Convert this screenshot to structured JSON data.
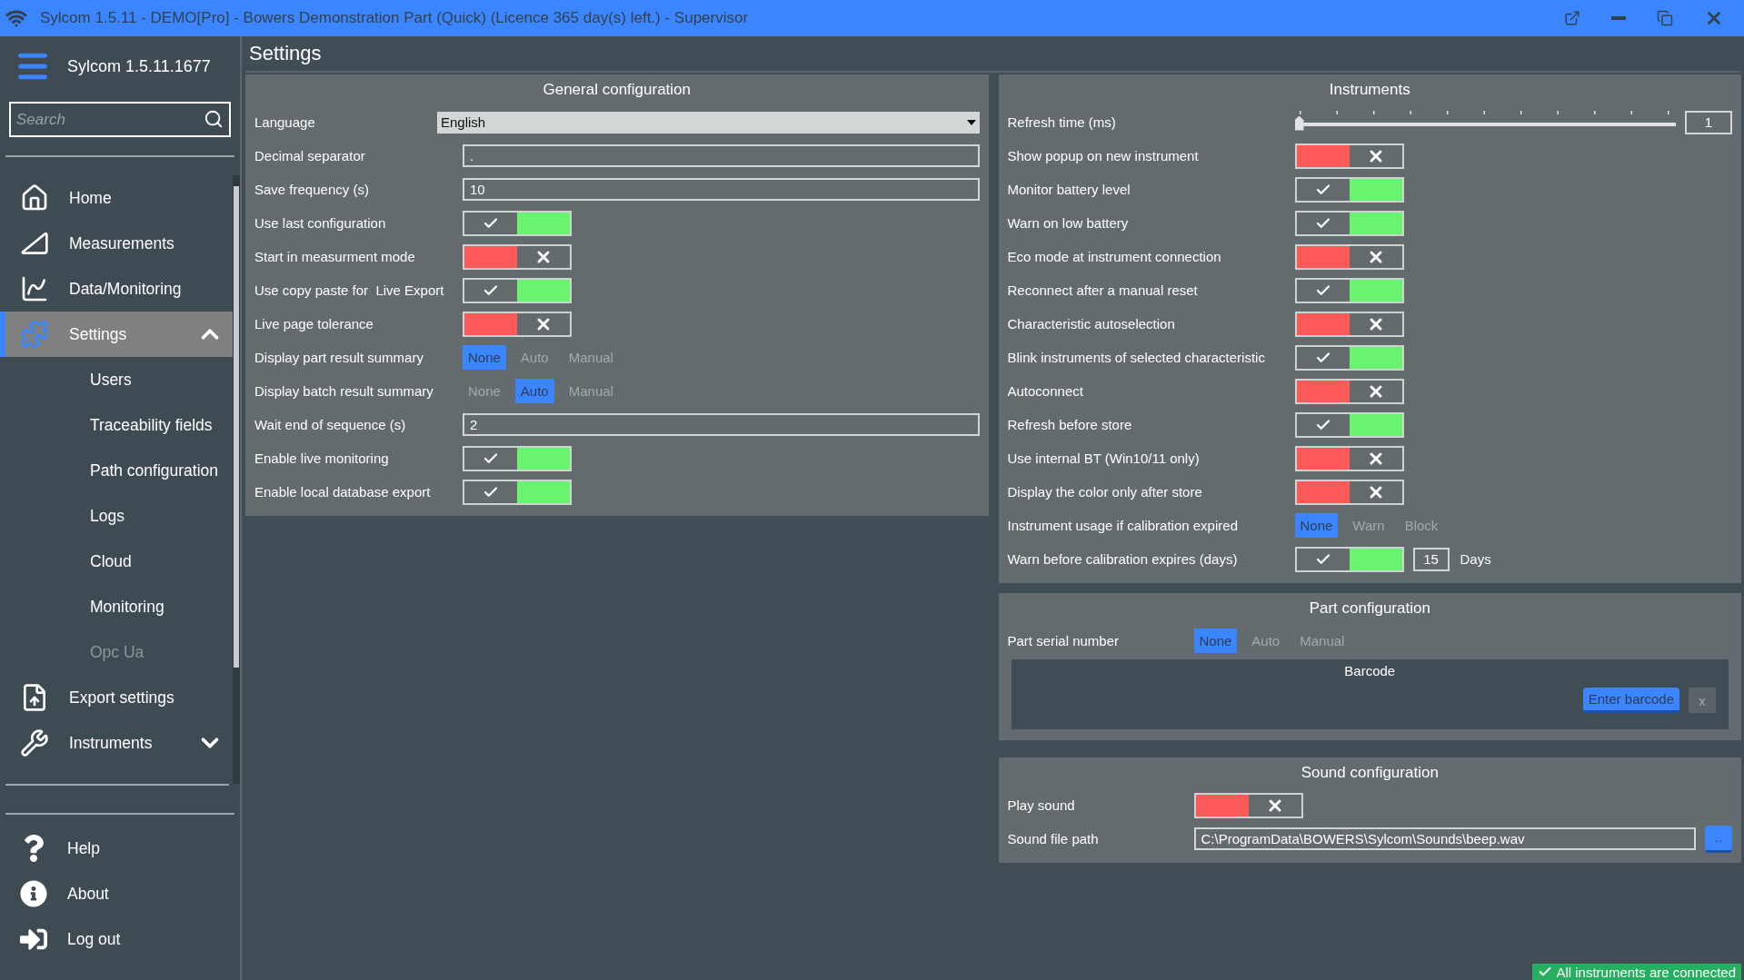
{
  "title_bar": {
    "title": "Sylcom 1.5.11 - DEMO[Pro] - Bowers Demonstration Part (Quick) (Licence 365 day(s) left.) - Supervisor"
  },
  "sidebar": {
    "app_name": "Sylcom 1.5.11.1677",
    "search_placeholder": "Search",
    "items": [
      {
        "label": "Home",
        "selected": false
      },
      {
        "label": "Measurements",
        "selected": false
      },
      {
        "label": "Data/Monitoring",
        "selected": false
      },
      {
        "label": "Settings",
        "selected": true,
        "expanded": true,
        "children": [
          {
            "label": "Users",
            "selected": false,
            "disabled": false
          },
          {
            "label": "Traceability fields",
            "selected": false,
            "disabled": false
          },
          {
            "label": "Path configuration",
            "selected": false,
            "disabled": false
          },
          {
            "label": "Logs",
            "selected": false,
            "disabled": false
          },
          {
            "label": "Cloud",
            "selected": false,
            "disabled": false
          },
          {
            "label": "Monitoring",
            "selected": false,
            "disabled": false
          },
          {
            "label": "Opc Ua",
            "selected": false,
            "disabled": true
          }
        ]
      },
      {
        "label": "Export settings",
        "selected": false
      },
      {
        "label": "Instruments",
        "selected": false,
        "expanded": false
      }
    ],
    "footer_items": [
      {
        "label": "Help"
      },
      {
        "label": "About"
      },
      {
        "label": "Log out"
      }
    ]
  },
  "page_title": "Settings",
  "general": {
    "title": "General configuration",
    "rows": [
      {
        "kind": "dropdown",
        "label": "Language",
        "value": "English"
      },
      {
        "kind": "text",
        "label": "Decimal separator",
        "value": "."
      },
      {
        "kind": "text",
        "label": "Save frequency (s)",
        "value": "10"
      },
      {
        "kind": "toggle",
        "label": "Use last configuration",
        "on": true
      },
      {
        "kind": "toggle",
        "label": "Start in measurment mode",
        "on": false
      },
      {
        "kind": "toggle",
        "label": "Use copy paste for  Live Export",
        "on": true
      },
      {
        "kind": "toggle",
        "label": "Live page tolerance",
        "on": false
      },
      {
        "kind": "choice",
        "label": "Display part result summary",
        "options": [
          {
            "label": "None",
            "selected": true
          },
          {
            "label": "Auto",
            "selected": false
          },
          {
            "label": "Manual",
            "selected": false
          }
        ]
      },
      {
        "kind": "choice",
        "label": "Display batch result summary",
        "options": [
          {
            "label": "None",
            "selected": false
          },
          {
            "label": "Auto",
            "selected": true
          },
          {
            "label": "Manual",
            "selected": false
          }
        ]
      },
      {
        "kind": "text",
        "label": "Wait end of sequence (s)",
        "value": "2"
      },
      {
        "kind": "toggle",
        "label": "Enable live monitoring",
        "on": true
      },
      {
        "kind": "toggle",
        "label": "Enable local database export",
        "on": true
      }
    ]
  },
  "instruments": {
    "title": "Instruments",
    "rows": [
      {
        "kind": "slider",
        "label": "Refresh time (ms)",
        "level": 0,
        "value": "1"
      },
      {
        "kind": "toggle",
        "label": "Show popup on new instrument",
        "on": false
      },
      {
        "kind": "toggle",
        "label": "Monitor battery level",
        "on": true
      },
      {
        "kind": "toggle",
        "label": "Warn on low battery",
        "on": true
      },
      {
        "kind": "toggle",
        "label": "Eco mode at instrument connection",
        "on": false
      },
      {
        "kind": "toggle",
        "label": "Reconnect after a manual reset",
        "on": true
      },
      {
        "kind": "toggle",
        "label": "Characteristic autoselection",
        "on": false
      },
      {
        "kind": "toggle",
        "label": "Blink instruments of selected characteristic",
        "on": true
      },
      {
        "kind": "toggle",
        "label": "Autoconnect",
        "on": false
      },
      {
        "kind": "toggle",
        "label": "Refresh before store",
        "on": true
      },
      {
        "kind": "toggle",
        "label": "Use internal BT (Win10/11 only)",
        "on": false
      },
      {
        "kind": "toggle",
        "label": "Display the color only after store",
        "on": false
      },
      {
        "kind": "choice",
        "label": "Instrument usage if calibration expired",
        "options": [
          {
            "label": "None",
            "selected": true
          },
          {
            "label": "Warn",
            "selected": false
          },
          {
            "label": "Block",
            "selected": false
          }
        ]
      },
      {
        "kind": "toggle_days",
        "label": "Warn before calibration expires (days)",
        "on": true,
        "value": "15",
        "unit": "Days"
      }
    ]
  },
  "part": {
    "title": "Part configuration",
    "rows": [
      {
        "kind": "choice",
        "label": "Part serial number",
        "options": [
          {
            "label": "None",
            "selected": true
          },
          {
            "label": "Auto",
            "selected": false
          },
          {
            "label": "Manual",
            "selected": false
          }
        ]
      }
    ],
    "barcode": {
      "title": "Barcode",
      "button": "Enter barcode",
      "clear": "x"
    }
  },
  "sound": {
    "title": "Sound configuration",
    "rows": [
      {
        "kind": "toggle",
        "label": "Play sound",
        "on": false
      },
      {
        "kind": "file",
        "label": "Sound file path",
        "value": "C:\\ProgramData\\BOWERS\\Sylcom\\Sounds\\beep.wav",
        "button": ".."
      }
    ]
  },
  "status": {
    "text": "All instruments are connected"
  }
}
